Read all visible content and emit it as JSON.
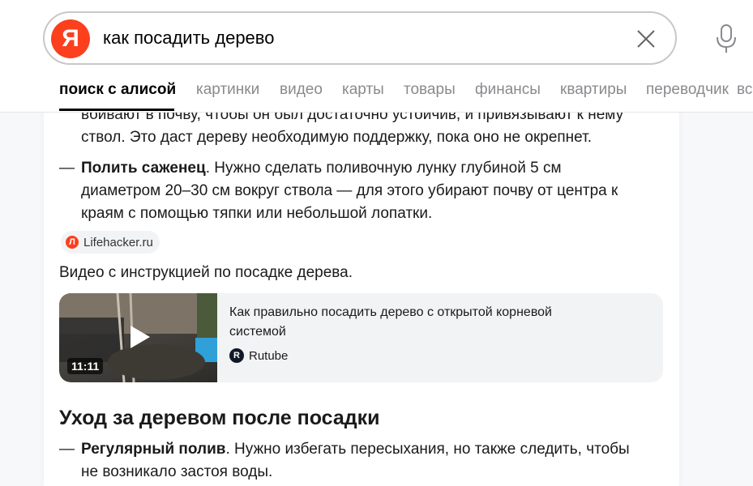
{
  "search": {
    "logo": "Я",
    "query": "как посадить дерево"
  },
  "tabs": [
    {
      "label": "поиск с алисой",
      "active": true
    },
    {
      "label": "картинки"
    },
    {
      "label": "видео"
    },
    {
      "label": "карты"
    },
    {
      "label": "товары"
    },
    {
      "label": "финансы"
    },
    {
      "label": "квартиры"
    },
    {
      "label": "переводчик"
    },
    {
      "label": "вс"
    }
  ],
  "article": {
    "p1_line1": "вбивают в почву, чтобы он был достаточно устойчив, и привязывают к нему",
    "p1_line2": "ствол. Это даст дереву необходимую поддержку, пока оно не окрепнет.",
    "step2_dash": "—",
    "step2_bold": "Полить саженец",
    "step2_line1_rest": ". Нужно сделать поливочную лунку глубиной 5 см",
    "step2_line2": "диаметром 20–30 см вокруг ствола — для этого убирают почву от центра к",
    "step2_line3": "краям с помощью тяпки или небольшой лопатки.",
    "source_chip_icon": "Л",
    "source_chip": "Lifehacker.ru",
    "video_intro": "Видео с инструкцией по посадке дерева.",
    "video": {
      "title_line1": "Как правильно посадить дерево с открытой корневой",
      "title_line2": "системой",
      "source_icon": "R",
      "source": "Rutube",
      "duration": "11:11"
    },
    "section_heading": "Уход за деревом после посадки",
    "step3_dash": "—",
    "step3_bold": "Регулярный полив",
    "step3_line1_rest": ". Нужно избегать пересыхания, но также следить, чтобы",
    "step3_line2": "не возникало застоя воды."
  },
  "colors": {
    "brand": "#fc3f1d",
    "active_tab": "#000000",
    "inactive_tab": "#8a8a8e"
  }
}
